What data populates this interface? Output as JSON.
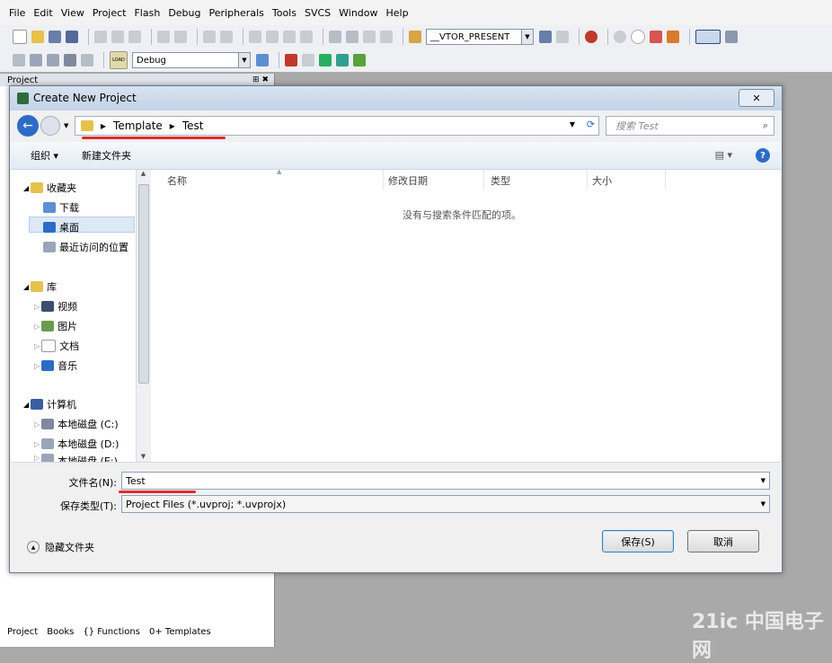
{
  "menu": [
    "File",
    "Edit",
    "View",
    "Project",
    "Flash",
    "Debug",
    "Peripherals",
    "Tools",
    "SVCS",
    "Window",
    "Help"
  ],
  "toolbar": {
    "target_combo": "__VTOR_PRESENT",
    "build_combo": "Debug",
    "load_label": "LOAD"
  },
  "project_panel": {
    "title": "Project",
    "tabs": [
      "Project",
      "Books",
      "{} Functions",
      "0+ Templates"
    ]
  },
  "dialog": {
    "title": "Create New Project",
    "close_label": "✕",
    "breadcrumb": [
      "Template",
      "Test"
    ],
    "search_placeholder": "搜索 Test",
    "organize": "组织 ▾",
    "new_folder": "新建文件夹",
    "view_label": "▤ ▾",
    "help_label": "?",
    "columns": [
      "名称",
      "修改日期",
      "类型",
      "大小"
    ],
    "empty_message": "没有与搜索条件匹配的项。",
    "nav": {
      "favorites": "收藏夹",
      "downloads": "下载",
      "desktop": "桌面",
      "recent": "最近访问的位置",
      "library": "库",
      "videos": "视频",
      "pictures": "图片",
      "documents": "文档",
      "music": "音乐",
      "computer": "计算机",
      "disk_c": "本地磁盘 (C:)",
      "disk_d": "本地磁盘 (D:)",
      "disk_e": "本地磁盘 (E:)"
    },
    "filename_label": "文件名(N):",
    "filename_value": "Test",
    "filetype_label": "保存类型(T):",
    "filetype_value": "Project Files (*.uvproj; *.uvprojx)",
    "hide_folders": "隐藏文件夹",
    "save_button": "保存(S)",
    "cancel_button": "取消"
  },
  "watermark": "21ic 中国电子网",
  "colors": {
    "accent": "#2d6cc5",
    "highlight": "#e22b2b",
    "folder": "#e6c14b"
  }
}
